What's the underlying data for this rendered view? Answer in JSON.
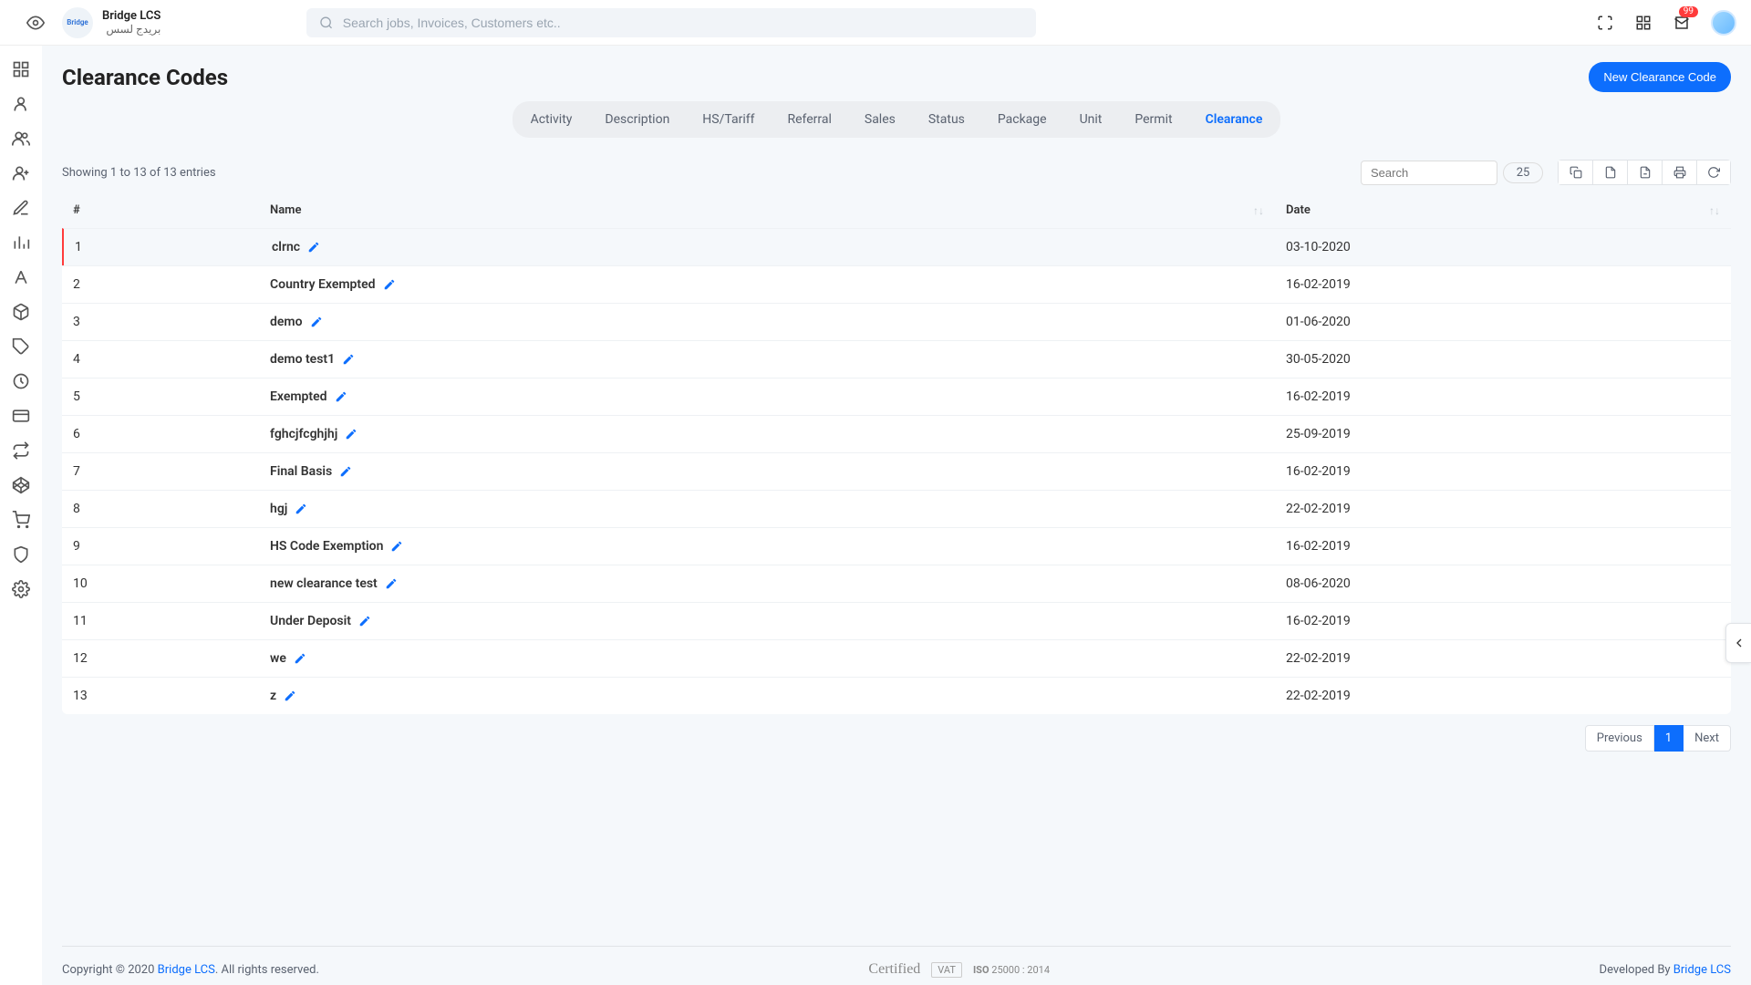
{
  "header": {
    "app_title": "Bridge LCS",
    "app_subtitle": "بريدج لسس",
    "logo_text": "Bridge",
    "search_placeholder": "Search jobs, Invoices, Customers etc..",
    "notification_count": "99"
  },
  "page": {
    "title": "Clearance Codes",
    "new_button": "New Clearance Code"
  },
  "tabs": [
    {
      "label": "Activity",
      "active": false
    },
    {
      "label": "Description",
      "active": false
    },
    {
      "label": "HS/Tariff",
      "active": false
    },
    {
      "label": "Referral",
      "active": false
    },
    {
      "label": "Sales",
      "active": false
    },
    {
      "label": "Status",
      "active": false
    },
    {
      "label": "Package",
      "active": false
    },
    {
      "label": "Unit",
      "active": false
    },
    {
      "label": "Permit",
      "active": false
    },
    {
      "label": "Clearance",
      "active": true
    }
  ],
  "table": {
    "info": "Showing 1 to 13 of 13 entries",
    "search_placeholder": "Search",
    "page_size": "25",
    "columns": {
      "num": "#",
      "name": "Name",
      "date": "Date"
    },
    "rows": [
      {
        "n": "1",
        "name": "clrnc",
        "date": "03-10-2020"
      },
      {
        "n": "2",
        "name": "Country Exempted",
        "date": "16-02-2019"
      },
      {
        "n": "3",
        "name": "demo",
        "date": "01-06-2020"
      },
      {
        "n": "4",
        "name": "demo test1",
        "date": "30-05-2020"
      },
      {
        "n": "5",
        "name": "Exempted",
        "date": "16-02-2019"
      },
      {
        "n": "6",
        "name": "fghcjfcghjhj",
        "date": "25-09-2019"
      },
      {
        "n": "7",
        "name": "Final Basis",
        "date": "16-02-2019"
      },
      {
        "n": "8",
        "name": "hgj",
        "date": "22-02-2019"
      },
      {
        "n": "9",
        "name": "HS Code Exemption",
        "date": "16-02-2019"
      },
      {
        "n": "10",
        "name": "new clearance test",
        "date": "08-06-2020"
      },
      {
        "n": "11",
        "name": "Under Deposit",
        "date": "16-02-2019"
      },
      {
        "n": "12",
        "name": "we",
        "date": "22-02-2019"
      },
      {
        "n": "13",
        "name": "z",
        "date": "22-02-2019"
      }
    ]
  },
  "pagination": {
    "prev": "Previous",
    "current": "1",
    "next": "Next"
  },
  "footer": {
    "copyright_prefix": "Copyright © 2020 ",
    "brand": "Bridge LCS",
    "copyright_suffix": ". All rights reserved.",
    "certified": "Certified",
    "vat": "VAT",
    "iso": "25000 : 2014",
    "iso_prefix": "ISO",
    "dev_prefix": "Developed By ",
    "dev_link": "Bridge LCS"
  }
}
